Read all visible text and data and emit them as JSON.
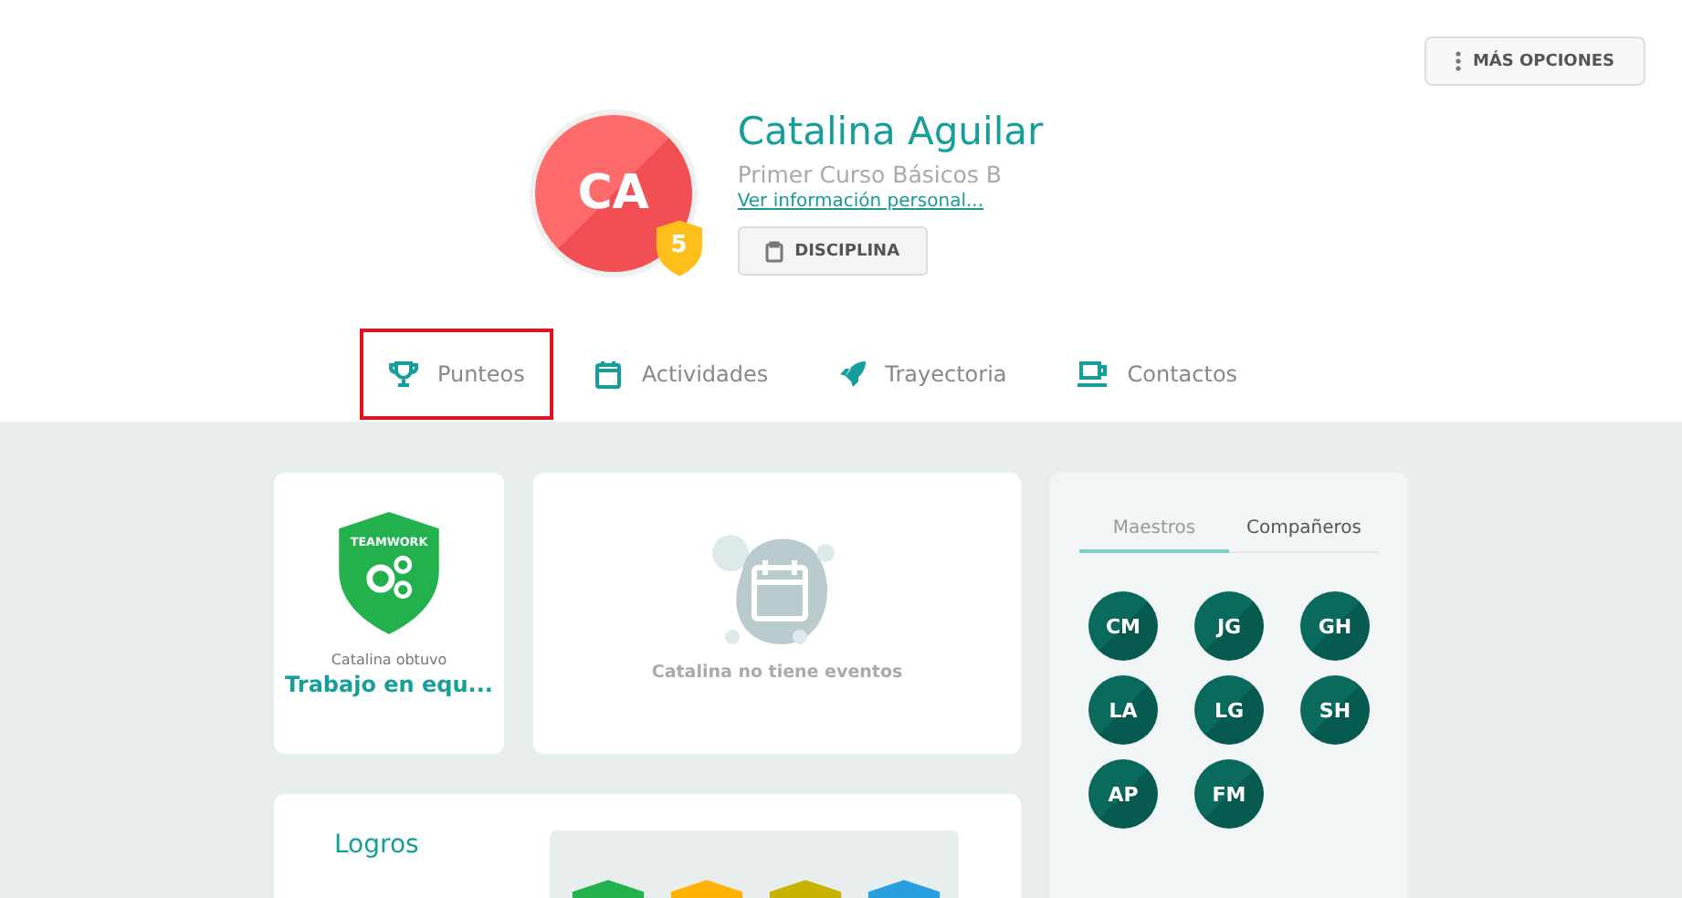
{
  "header": {
    "more_button": "MÁS OPCIONES",
    "avatar": {
      "initials": "CA",
      "level": "5"
    },
    "name": "Catalina Aguilar",
    "course": "Primer Curso Básicos B",
    "info_link": "Ver información personal...",
    "discipline_button": "DISCIPLINA"
  },
  "tabs": [
    {
      "label": "Punteos",
      "kind": "trophy",
      "highlighted": true
    },
    {
      "label": "Actividades",
      "kind": "calendar",
      "highlighted": false
    },
    {
      "label": "Trayectoria",
      "kind": "rocket",
      "highlighted": false
    },
    {
      "label": "Contactos",
      "kind": "cup",
      "highlighted": false
    }
  ],
  "achievement_card": {
    "badge_text": "TEAMWORK",
    "caption": "Catalina obtuvo",
    "title": "Trabajo en equ..."
  },
  "events_card": {
    "empty_text": "Catalina no tiene eventos"
  },
  "contacts": {
    "tabs": [
      {
        "label": "Maestros",
        "selected": true
      },
      {
        "label": "Compañeros",
        "selected": false
      }
    ],
    "people": [
      {
        "initials": "CM"
      },
      {
        "initials": "JG"
      },
      {
        "initials": "GH"
      },
      {
        "initials": "LA"
      },
      {
        "initials": "LG"
      },
      {
        "initials": "SH"
      },
      {
        "initials": "AP"
      },
      {
        "initials": "FM"
      }
    ]
  },
  "logros": {
    "title": "Logros",
    "badges": [
      {
        "color": "#22b14c"
      },
      {
        "color": "#ffb300"
      },
      {
        "color": "#c8b400"
      },
      {
        "color": "#2a9fe0"
      }
    ]
  }
}
